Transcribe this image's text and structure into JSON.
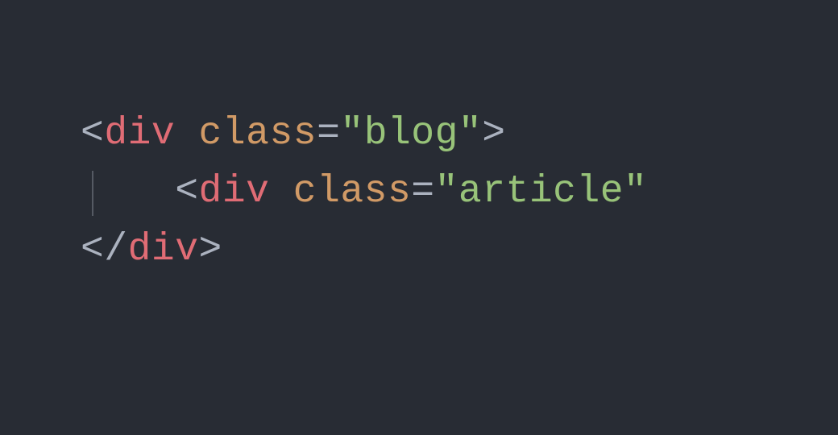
{
  "code": {
    "lines": [
      {
        "indent": 0,
        "tokens": [
          {
            "cls": "bracket",
            "text": "<"
          },
          {
            "cls": "tag",
            "text": "div"
          },
          {
            "cls": "bracket",
            "text": " "
          },
          {
            "cls": "attr",
            "text": "class"
          },
          {
            "cls": "bracket",
            "text": "="
          },
          {
            "cls": "string",
            "text": "\"blog\""
          },
          {
            "cls": "bracket",
            "text": ">"
          }
        ]
      },
      {
        "indent": 1,
        "tokens": [
          {
            "cls": "bracket",
            "text": "<"
          },
          {
            "cls": "tag",
            "text": "div"
          },
          {
            "cls": "bracket",
            "text": " "
          },
          {
            "cls": "attr",
            "text": "class"
          },
          {
            "cls": "bracket",
            "text": "="
          },
          {
            "cls": "string",
            "text": "\"article\""
          }
        ]
      },
      {
        "indent": 0,
        "tokens": [
          {
            "cls": "bracket",
            "text": "</"
          },
          {
            "cls": "tag",
            "text": "div"
          },
          {
            "cls": "bracket",
            "text": ">"
          }
        ]
      }
    ],
    "indent_unit": "    "
  },
  "colors": {
    "background": "#282c34",
    "bracket": "#abb2bf",
    "tag": "#e06c75",
    "attr": "#d19a66",
    "string": "#98c379",
    "indent_guide": "#555a63"
  }
}
